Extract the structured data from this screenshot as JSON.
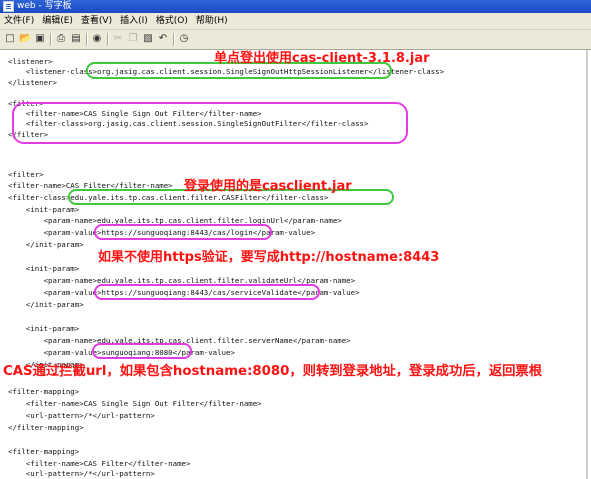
{
  "window": {
    "title": "web - 写字板"
  },
  "menu": [
    "文件(F)",
    "编辑(E)",
    "查看(V)",
    "插入(I)",
    "格式(O)",
    "帮助(H)"
  ],
  "lines": [
    {
      "text": "<listener>"
    },
    {
      "text": "    <listener-class>org.jasig.cas.client.session.SingleSignOutHttpSessionListener</listener-class>"
    },
    {
      "text": "</listener>"
    },
    {
      "text": ""
    },
    {
      "text": "<filter>"
    },
    {
      "text": "    <filter-name>CAS Single Sign Out Filter</filter-name>"
    },
    {
      "text": "    <filter-class>org.jasig.cas.client.session.SingleSignOutFilter</filter-class>"
    },
    {
      "text": "</filter>"
    },
    {
      "text": ""
    },
    {
      "text": ""
    },
    {
      "text": "<filter>"
    },
    {
      "text": "<filter-name>CAS Filter</filter-name>"
    },
    {
      "text": "<filter-class>edu.yale.its.tp.cas.client.filter.CASFilter</filter-class>"
    },
    {
      "text": "    <init-param>"
    },
    {
      "text": "        <param-name>edu.yale.its.tp.cas.client.filter.loginUrl</param-name>"
    },
    {
      "text": "        <param-value>https://sunguoqiang:8443/cas/login</param-value>"
    },
    {
      "text": "    </init-param>"
    },
    {
      "text": ""
    },
    {
      "text": "    <init-param>"
    },
    {
      "text": "        <param-name>edu.yale.its.tp.cas.client.filter.validateUrl</param-name>"
    },
    {
      "text": "        <param-value>https://sunguoqiang:8443/cas/serviceValidate</param-value>"
    },
    {
      "text": "    </init-param>"
    },
    {
      "text": ""
    },
    {
      "text": "    <init-param>"
    },
    {
      "text": "        <param-name>edu.yale.its.tp.cas.client.filter.serverName</param-name>"
    },
    {
      "text": "        <param-value>sunguoqiang:8080</param-value>"
    },
    {
      "text": "    </init-param>"
    },
    {
      "text": ""
    },
    {
      "text": "<filter-mapping>"
    },
    {
      "text": "    <filter-name>CAS Single Sign Out Filter</filter-name>"
    },
    {
      "text": "    <url-pattern>/*</url-pattern>"
    },
    {
      "text": "</filter-mapping>"
    },
    {
      "text": ""
    },
    {
      "text": "<filter-mapping>"
    },
    {
      "text": "    <filter-name>CAS Filter</filter-name>"
    },
    {
      "text": "    <url-pattern>/*</url-pattern>"
    }
  ],
  "annotations": {
    "sso": "单点登出使用cas-client-3.1.8.jar",
    "casclient": "登录使用的是casclient.jar",
    "https": "如果不使用https验证，要写成http://hostname:8443",
    "intercept": "CAS通过拦截url，如果包含hostname:8080，则转到登录地址，登录成功后，返回票根"
  }
}
